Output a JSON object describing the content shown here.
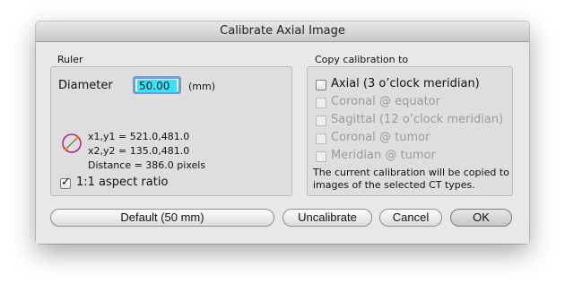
{
  "window": {
    "title": "Calibrate Axial Image"
  },
  "ruler": {
    "group_label": "Ruler",
    "diameter_label": "Diameter",
    "diameter_value": "50.00",
    "diameter_unit": "(mm)",
    "coord1": "x1,y1 = 521.0,481.0",
    "coord2": "x2,y2 = 135.0,481.0",
    "distance": "Distance = 386.0 pixels",
    "aspect_label": "1:1 aspect ratio",
    "aspect_checked": true
  },
  "copy": {
    "group_label": "Copy calibration to",
    "options": [
      {
        "label": "Axial (3 o’clock meridian)",
        "enabled": true,
        "checked": false
      },
      {
        "label": "Coronal @ equator",
        "enabled": false,
        "checked": false
      },
      {
        "label": "Sagittal (12 o’clock meridian)",
        "enabled": false,
        "checked": false
      },
      {
        "label": "Coronal @ tumor",
        "enabled": false,
        "checked": false
      },
      {
        "label": "Meridian @ tumor",
        "enabled": false,
        "checked": false
      }
    ],
    "note_line1": "The current calibration will be copied to",
    "note_line2": "images of the selected CT types."
  },
  "buttons": {
    "default_label": "Default (50 mm)",
    "uncalibrate_label": "Uncalibrate",
    "cancel_label": "Cancel",
    "ok_label": "OK"
  },
  "colors": {
    "selection": "#35e4ff",
    "focus_ring": "#6f9bd6",
    "ruler_icon": "#b0207a"
  },
  "icons": {
    "ruler": "calibration-ruler-icon"
  }
}
